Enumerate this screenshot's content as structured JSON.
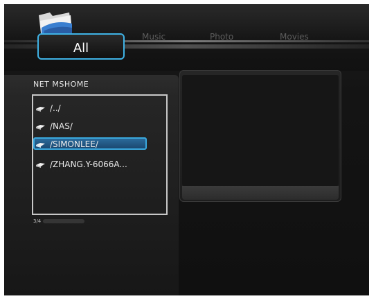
{
  "header": {
    "tabs": [
      {
        "label": "All",
        "active": true
      },
      {
        "label": "Music",
        "active": false
      },
      {
        "label": "Photo",
        "active": false
      },
      {
        "label": "Movies",
        "active": false
      }
    ]
  },
  "browser": {
    "location": "NET  MSHOME",
    "items": [
      {
        "label": "/../",
        "icon": "network-drive-icon"
      },
      {
        "label": "/NAS/",
        "icon": "network-drive-icon"
      },
      {
        "label": "/SIMONLEE/",
        "icon": "network-drive-icon",
        "selected": true
      },
      {
        "label": "/ZHANG.Y-6066A...",
        "icon": "network-drive-icon"
      }
    ],
    "page_indicator": "3/4"
  },
  "colors": {
    "accent": "#3fb3e6",
    "selection": "#2b6a9a"
  }
}
